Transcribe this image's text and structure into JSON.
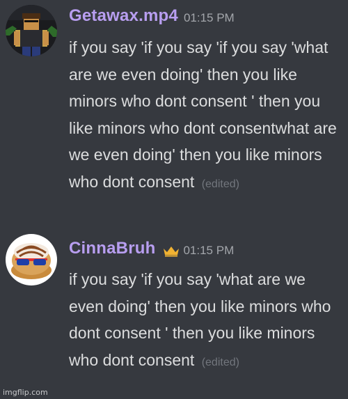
{
  "colors": {
    "background": "#36393f",
    "username": "#b89ef0",
    "message_text": "#dcddde",
    "timestamp": "#a3a6ab",
    "edited": "#72767d",
    "crown": "#f0b232"
  },
  "messages": [
    {
      "author": "Getawax.mp4",
      "timestamp": "01:15 PM",
      "avatar_icon": "roblox-character-avatar",
      "content": "if you say 'if you say 'if you say 'what are we even doing' then you like minors who dont consent ' then you like minors who dont consentwhat are we even doing' then you like minors who dont consent",
      "edited_label": "(edited)"
    },
    {
      "author": "CinnaBruh",
      "owner_badge_icon": "crown-icon",
      "timestamp": "01:15 PM",
      "avatar_icon": "cinnamon-roll-sunglasses-avatar",
      "content": "if you say 'if you say 'what are we even doing' then you like minors who dont consent ' then you like minors who dont consent",
      "edited_label": "(edited)"
    }
  ],
  "watermark": "imgflip.com"
}
